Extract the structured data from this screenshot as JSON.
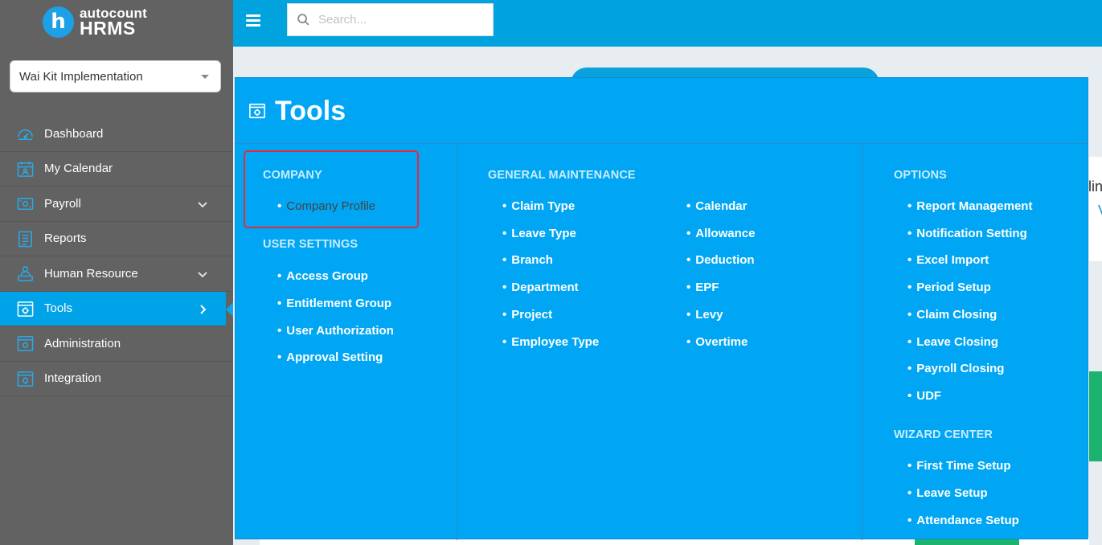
{
  "logo": {
    "badge": "h",
    "brand_top": "autocount",
    "brand_bottom": "HRMS"
  },
  "company_select": {
    "value": "Wai Kit Implementation"
  },
  "nav": [
    {
      "label": "Dashboard",
      "icon": "dashboard-icon"
    },
    {
      "label": "My Calendar",
      "icon": "calendar-user-icon"
    },
    {
      "label": "Payroll",
      "icon": "payroll-icon",
      "chevron": "down"
    },
    {
      "label": "Reports",
      "icon": "reports-icon"
    },
    {
      "label": "Human Resource",
      "icon": "human-resource-icon",
      "chevron": "down"
    },
    {
      "label": "Tools",
      "icon": "tools-icon",
      "chevron": "right",
      "active": true
    },
    {
      "label": "Administration",
      "icon": "administration-icon"
    },
    {
      "label": "Integration",
      "icon": "integration-icon"
    }
  ],
  "search": {
    "placeholder": "Search..."
  },
  "mega": {
    "title": "Tools",
    "company": {
      "heading": "COMPANY",
      "items": [
        "Company Profile"
      ]
    },
    "user_settings": {
      "heading": "USER SETTINGS",
      "items": [
        "Access Group",
        "Entitlement Group",
        "User Authorization",
        "Approval Setting"
      ]
    },
    "general": {
      "heading": "GENERAL MAINTENANCE",
      "col1": [
        "Claim Type",
        "Leave Type",
        "Branch",
        "Department",
        "Project",
        "Employee Type"
      ],
      "col2": [
        "Calendar",
        "Allowance",
        "Deduction",
        "EPF",
        "Levy",
        "Overtime"
      ]
    },
    "options": {
      "heading": "OPTIONS",
      "items": [
        "Report Management",
        "Notification Setting",
        "Excel Import",
        "Period Setup",
        "Claim Closing",
        "Leave Closing",
        "Payroll Closing",
        "UDF"
      ]
    },
    "wizard": {
      "heading": "WIZARD CENTER",
      "items": [
        "First Time Setup",
        "Leave Setup",
        "Attendance Setup"
      ]
    }
  },
  "background": {
    "partial_text": "lin",
    "partial_link": "V"
  },
  "colors": {
    "sidebar": "#626262",
    "accent": "#00a3dd",
    "menu": "#00a6f4",
    "highlight_border": "#e32b3b"
  }
}
